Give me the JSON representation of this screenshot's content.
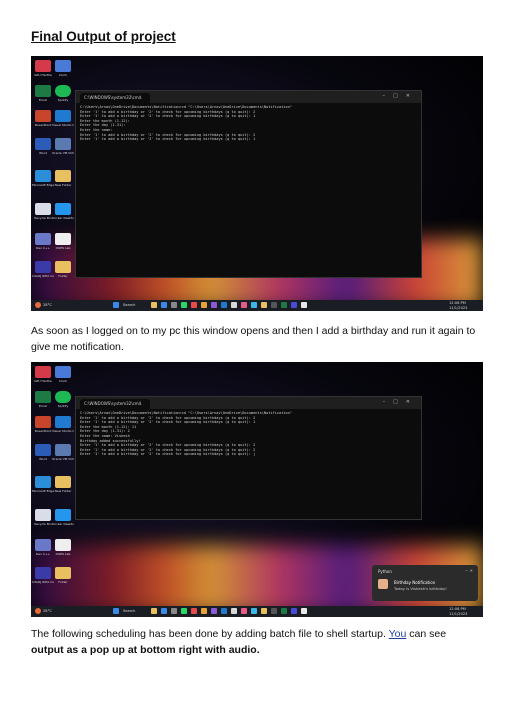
{
  "heading": "Final Output of project",
  "paragraph1": "As soon as I logged on to my pc this window opens and then I add a birthday and run it again to give me notification.",
  "paragraph2_before": "The following scheduling has been done by adding batch file to shell startup. ",
  "paragraph2_link": "You",
  "paragraph2_after": " can see",
  "paragraph2_bold": "output as a pop up at bottom right with audio.",
  "screenshot1": {
    "tab_title": "C:\\WINDOWS\\system32\\cmd.",
    "console_text": "C:\\Users\\Arnav\\OneDrive\\Documents\\Notification>cd \"C:\\Users\\Arnav\\OneDrive\\Documents\\Notification\"\nEnter '1' to add a birthday or '2' to check for upcoming birthdays (q to quit): 2\nEnter '1' to add a birthday or '2' to check for upcoming birthdays (q to quit): 1\nEnter the month (1-12):\nEnter the day (1-31):\nEnter the name:\nEnter '1' to add a birthday or '2' to check for upcoming birthdays (q to quit): 2\nEnter '1' to add a birthday or '2' to check for upcoming birthdays (q to quit): 1",
    "search_label": "Search",
    "weather": "28°C",
    "time": "12:08 PM",
    "date": "11/1/2023"
  },
  "screenshot2": {
    "tab_title": "C:\\WINDOWS\\system32\\cmd.",
    "console_text": "C:\\Users\\Arnav\\OneDrive\\Documents\\Notification>cd \"C:\\Users\\Arnav\\OneDrive\\Documents\\Notification\"\nEnter '1' to add a birthday or '2' to check for upcoming birthdays (q to quit): 2\nEnter '1' to add a birthday or '2' to check for upcoming birthdays (q to quit): 1\nEnter the month (1-12): 11\nEnter the day (1-31): 2\nEnter the name: Vishesh\nBirthday added successfully!\nEnter '1' to add a birthday or '2' to check for upcoming birthdays (q to quit): 2\nEnter '1' to add a birthday or '2' to check for upcoming birthdays (q to quit): 2\nEnter '1' to add a birthday or '2' to check for upcoming birthdays (q to quit): |",
    "search_label": "Search",
    "weather": "28°C",
    "time": "12:08 PM",
    "date": "11/1/2023",
    "toast": {
      "app": "Python",
      "title": "Birthday Notification",
      "body": "Today is Vishesh's birthday!"
    }
  },
  "desktop_icons": [
    "GPU Hartha",
    "Clock",
    "Excel",
    "Spotify",
    "PowerPoint",
    "Visual Studio Code",
    "Word",
    "Oracle VM VirtualBox",
    "Microsoft Edge",
    "New Folder",
    "Recycle Bin",
    "Docker Desktop",
    "Dev C++",
    "OOPS Lab",
    "IntelliJ IDEA Community",
    "Folder"
  ]
}
